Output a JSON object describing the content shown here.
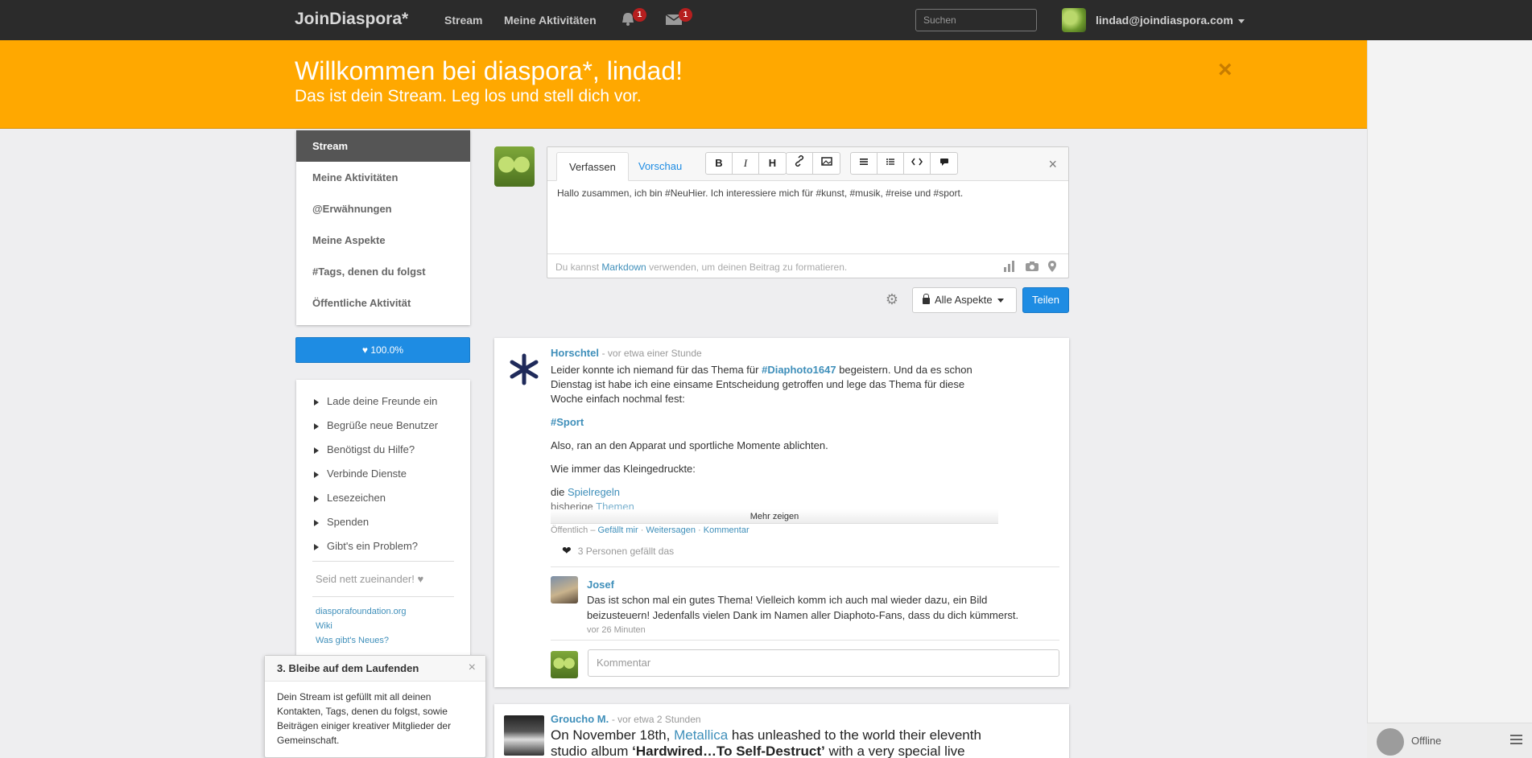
{
  "header": {
    "brand": "JoinDiaspora*",
    "nav": [
      "Stream",
      "Meine Aktivitäten"
    ],
    "notifications_count": "1",
    "messages_count": "1",
    "search_placeholder": "Suchen",
    "user": "lindad@joindiaspora.com"
  },
  "welcome": {
    "title": "Willkommen bei diaspora*, lindad!",
    "subtitle": "Das ist dein Stream. Leg los und stell dich vor.",
    "close": "×"
  },
  "sidebar": {
    "items": [
      "Stream",
      "Meine Aktivitäten",
      "@Erwähnungen",
      "Meine Aspekte",
      "#Tags, denen du folgst",
      "Öffentliche Aktivität"
    ],
    "like_bar": "♥ 100.0%",
    "links": [
      "Lade deine Freunde ein",
      "Begrüße neue Benutzer",
      "Benötigst du Hilfe?",
      "Verbinde Dienste",
      "Lesezeichen",
      "Spenden",
      "Gibt's ein Problem?"
    ],
    "be_nice": "Seid nett zueinander! ♥",
    "footer": [
      "diasporafoundation.org",
      "Wiki",
      "Was gibt's Neues?"
    ]
  },
  "publisher": {
    "tab_compose": "Verfassen",
    "tab_preview": "Vorschau",
    "tools": [
      "B",
      "I",
      "H"
    ],
    "text": "Hallo zusammen, ich bin #NeuHier. Ich interessiere mich für #kunst, #musik, #reise und #sport.",
    "hint_pre": "Du kannst",
    "hint_link": "Markdown",
    "hint_post": "verwenden, um deinen Beitrag zu formatieren.",
    "aspects": "Alle Aspekte",
    "share": "Teilen"
  },
  "post1": {
    "author": "Horschtel",
    "time": "- vor etwa einer Stunde",
    "line1_pre": "Leider konnte ich niemand für das Thema für",
    "line1_tag": "#Diaphoto1647",
    "line1_post": "begeistern. Und da es schon Dienstag ist habe ich eine einsame Entscheidung getroffen und lege das Thema für diese Woche einfach nochmal fest:",
    "tag": "#Sport",
    "para2": "Also, ran an den Apparat und sportliche Momente ablichten.",
    "para3": "Wie immer das Kleingedruckte:",
    "rules_pre": "die",
    "rules_link": "Spielregeln",
    "topics_pre": "bisherige",
    "topics_link": "Themen",
    "show_more": "Mehr zeigen",
    "visibility": "Öffentlich",
    "like": "Gefällt mir",
    "reshare": "Weitersagen",
    "comment": "Kommentar",
    "likes": "3 Personen gefällt das",
    "comment_author": "Josef",
    "comment_text": "Das ist schon mal ein gutes Thema! Vielleich komm ich auch mal wieder dazu, ein Bild beizusteuern! Jedenfalls vielen Dank im Namen aller Diaphoto-Fans, dass du dich kümmerst.",
    "comment_time": "vor 26 Minuten",
    "comment_placeholder": "Kommentar"
  },
  "post2": {
    "author": "Groucho M.",
    "time": "- vor etwa 2 Stunden",
    "text_pre": "On November 18th,",
    "text_link": "Metallica",
    "text_mid": "has unleashed to the world their eleventh studio album",
    "text_bold": "‘Hardwired…To Self-Destruct’",
    "text_post": "with a very special live"
  },
  "popover": {
    "title": "3. Bleibe auf dem Laufenden",
    "body": "Dein Stream ist gefüllt mit all deinen Kontakten, Tags, denen du folgst, sowie Beiträgen einiger kreativer Mitglieder der Gemeinschaft."
  },
  "chat": {
    "status": "Offline"
  }
}
